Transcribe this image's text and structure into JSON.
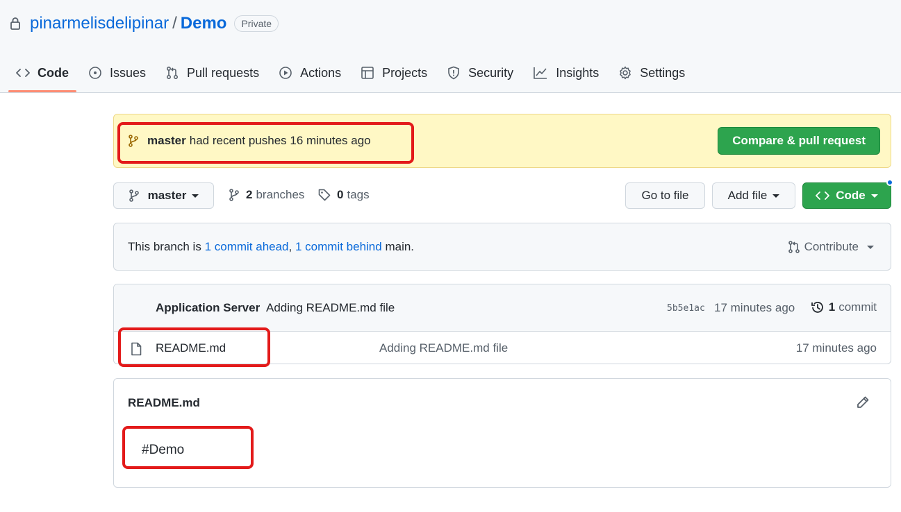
{
  "repo": {
    "owner": "pinarmelisdelipinar",
    "separator": "/",
    "name": "Demo",
    "visibility": "Private"
  },
  "tabs": [
    {
      "label": "Code",
      "icon": "code-icon",
      "active": true
    },
    {
      "label": "Issues",
      "icon": "issue-circle-icon"
    },
    {
      "label": "Pull requests",
      "icon": "pull-request-icon"
    },
    {
      "label": "Actions",
      "icon": "play-circle-icon"
    },
    {
      "label": "Projects",
      "icon": "table-icon"
    },
    {
      "label": "Security",
      "icon": "shield-icon"
    },
    {
      "label": "Insights",
      "icon": "graph-icon"
    },
    {
      "label": "Settings",
      "icon": "gear-icon"
    }
  ],
  "push_banner": {
    "branch": "master",
    "message": "had recent pushes 16 minutes ago",
    "button": "Compare & pull request"
  },
  "toolbar": {
    "branch_selector": "master",
    "branches_count": "2",
    "branches_label": "branches",
    "tags_count": "0",
    "tags_label": "tags",
    "go_to_file": "Go to file",
    "add_file": "Add file",
    "code": "Code"
  },
  "branch_info": {
    "prefix": "This branch is",
    "ahead": "1 commit ahead",
    "comma": ",",
    "behind": "1 commit behind",
    "suffix": "main.",
    "contribute": "Contribute"
  },
  "latest_commit": {
    "author": "Application Server",
    "message": "Adding README.md file",
    "sha": "5b5e1ac",
    "age": "17 minutes ago",
    "count": "1",
    "count_label": "commit"
  },
  "files": [
    {
      "name": "README.md",
      "message": "Adding README.md file",
      "age": "17 minutes ago"
    }
  ],
  "readme": {
    "title": "README.md",
    "content": "#Demo"
  },
  "colors": {
    "link": "#0969da",
    "primary_button": "#2da44e",
    "banner_bg": "#fff8c5",
    "active_tab_underline": "#fd8c73",
    "annotation": "#e31a1a"
  }
}
